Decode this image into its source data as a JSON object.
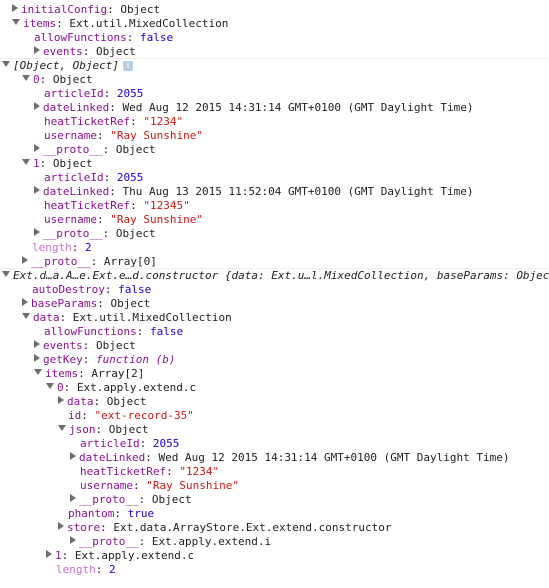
{
  "colors": {
    "key": "#881391",
    "key_dim": "#c46fcf",
    "number": "#1c00cf",
    "string": "#c41a16",
    "object": "#222222",
    "arrow": "#6e6e6e",
    "info_badge": "#b8cce4"
  },
  "info_badge_icon": "info-icon",
  "info_badge_text": "i",
  "rows": [
    {
      "indent": 12,
      "arrow": "c",
      "key": "initialConfig",
      "kt": "k",
      "val": "Object",
      "vt": "v-obj"
    },
    {
      "indent": 12,
      "arrow": "e",
      "key": "items",
      "kt": "k",
      "val": "Ext.util.MixedCollection",
      "vt": "v-obj"
    },
    {
      "indent": 34,
      "arrow": "",
      "key": "allowFunctions",
      "kt": "k",
      "val": "false",
      "vt": "v-bool"
    },
    {
      "indent": 34,
      "arrow": "c",
      "key": "events",
      "kt": "k",
      "val": "Object",
      "vt": "v-obj"
    },
    {
      "indent": 2,
      "arrow": "e",
      "key": "",
      "kt": "k",
      "val": "[Object, Object]",
      "vt": "v-sum",
      "badge": true,
      "divider": true
    },
    {
      "indent": 22,
      "arrow": "e",
      "key": "0",
      "kt": "k",
      "val": "Object",
      "vt": "v-obj"
    },
    {
      "indent": 44,
      "arrow": "",
      "key": "articleId",
      "kt": "k",
      "val": "2055",
      "vt": "v-num"
    },
    {
      "indent": 34,
      "arrow": "c",
      "key": "dateLinked",
      "kt": "k",
      "val": "Wed Aug 12 2015 14:31:14 GMT+0100 (GMT Daylight Time)",
      "vt": "v-obj"
    },
    {
      "indent": 44,
      "arrow": "",
      "key": "heatTicketRef",
      "kt": "k",
      "val": "\"1234\"",
      "vt": "v-str"
    },
    {
      "indent": 44,
      "arrow": "",
      "key": "username",
      "kt": "k",
      "val": "\"Ray Sunshine\"",
      "vt": "v-str"
    },
    {
      "indent": 34,
      "arrow": "c",
      "key": "__proto__",
      "kt": "k",
      "val": "Object",
      "vt": "v-obj"
    },
    {
      "indent": 22,
      "arrow": "e",
      "key": "1",
      "kt": "k",
      "val": "Object",
      "vt": "v-obj"
    },
    {
      "indent": 44,
      "arrow": "",
      "key": "articleId",
      "kt": "k",
      "val": "2055",
      "vt": "v-num"
    },
    {
      "indent": 34,
      "arrow": "c",
      "key": "dateLinked",
      "kt": "k",
      "val": "Thu Aug 13 2015 11:52:04 GMT+0100 (GMT Daylight Time)",
      "vt": "v-obj"
    },
    {
      "indent": 44,
      "arrow": "",
      "key": "heatTicketRef",
      "kt": "k",
      "val": "\"12345\"",
      "vt": "v-str"
    },
    {
      "indent": 44,
      "arrow": "",
      "key": "username",
      "kt": "k",
      "val": "\"Ray Sunshine\"",
      "vt": "v-str"
    },
    {
      "indent": 34,
      "arrow": "c",
      "key": "__proto__",
      "kt": "k",
      "val": "Object",
      "vt": "v-obj"
    },
    {
      "indent": 32,
      "arrow": "",
      "key": "length",
      "kt": "kd",
      "val": "2",
      "vt": "v-num"
    },
    {
      "indent": 22,
      "arrow": "c",
      "key": "__proto__",
      "kt": "k",
      "val": "Array[0]",
      "vt": "v-obj"
    },
    {
      "indent": 2,
      "arrow": "e",
      "key": "",
      "kt": "k",
      "val": "Ext.d…a.A…e.Ext.e…d.constructor {data: Ext.u…l.MixedCollection, baseParams: Object",
      "vt": "v-sum",
      "divider": true
    },
    {
      "indent": 32,
      "arrow": "",
      "key": "autoDestroy",
      "kt": "k",
      "val": "false",
      "vt": "v-bool"
    },
    {
      "indent": 22,
      "arrow": "c",
      "key": "baseParams",
      "kt": "k",
      "val": "Object",
      "vt": "v-obj"
    },
    {
      "indent": 22,
      "arrow": "e",
      "key": "data",
      "kt": "k",
      "val": "Ext.util.MixedCollection",
      "vt": "v-obj"
    },
    {
      "indent": 44,
      "arrow": "",
      "key": "allowFunctions",
      "kt": "k",
      "val": "false",
      "vt": "v-bool"
    },
    {
      "indent": 34,
      "arrow": "c",
      "key": "events",
      "kt": "k",
      "val": "Object",
      "vt": "v-obj"
    },
    {
      "indent": 34,
      "arrow": "c",
      "key": "getKey",
      "kt": "k",
      "val": "function (b)",
      "vt": "v-fn"
    },
    {
      "indent": 34,
      "arrow": "e",
      "key": "items",
      "kt": "k",
      "val": "Array[2]",
      "vt": "v-obj"
    },
    {
      "indent": 46,
      "arrow": "e",
      "key": "0",
      "kt": "k",
      "val": "Ext.apply.extend.c",
      "vt": "v-obj"
    },
    {
      "indent": 58,
      "arrow": "c",
      "key": "data",
      "kt": "k",
      "val": "Object",
      "vt": "v-obj"
    },
    {
      "indent": 68,
      "arrow": "",
      "key": "id",
      "kt": "k",
      "val": "\"ext-record-35\"",
      "vt": "v-str"
    },
    {
      "indent": 58,
      "arrow": "e",
      "key": "json",
      "kt": "k",
      "val": "Object",
      "vt": "v-obj"
    },
    {
      "indent": 80,
      "arrow": "",
      "key": "articleId",
      "kt": "k",
      "val": "2055",
      "vt": "v-num"
    },
    {
      "indent": 70,
      "arrow": "c",
      "key": "dateLinked",
      "kt": "k",
      "val": "Wed Aug 12 2015 14:31:14 GMT+0100 (GMT Daylight Time)",
      "vt": "v-obj"
    },
    {
      "indent": 80,
      "arrow": "",
      "key": "heatTicketRef",
      "kt": "k",
      "val": "\"1234\"",
      "vt": "v-str"
    },
    {
      "indent": 80,
      "arrow": "",
      "key": "username",
      "kt": "k",
      "val": "\"Ray Sunshine\"",
      "vt": "v-str"
    },
    {
      "indent": 70,
      "arrow": "c",
      "key": "__proto__",
      "kt": "k",
      "val": "Object",
      "vt": "v-obj"
    },
    {
      "indent": 68,
      "arrow": "",
      "key": "phantom",
      "kt": "k",
      "val": "true",
      "vt": "v-bool"
    },
    {
      "indent": 58,
      "arrow": "c",
      "key": "store",
      "kt": "k",
      "val": "Ext.data.ArrayStore.Ext.extend.constructor",
      "vt": "v-obj"
    },
    {
      "indent": 70,
      "arrow": "c",
      "key": "__proto__",
      "kt": "k",
      "val": "Ext.apply.extend.i",
      "vt": "v-obj"
    },
    {
      "indent": 46,
      "arrow": "c",
      "key": "1",
      "kt": "k",
      "val": "Ext.apply.extend.c",
      "vt": "v-obj"
    },
    {
      "indent": 56,
      "arrow": "",
      "key": "length",
      "kt": "kd",
      "val": "2",
      "vt": "v-num"
    }
  ]
}
